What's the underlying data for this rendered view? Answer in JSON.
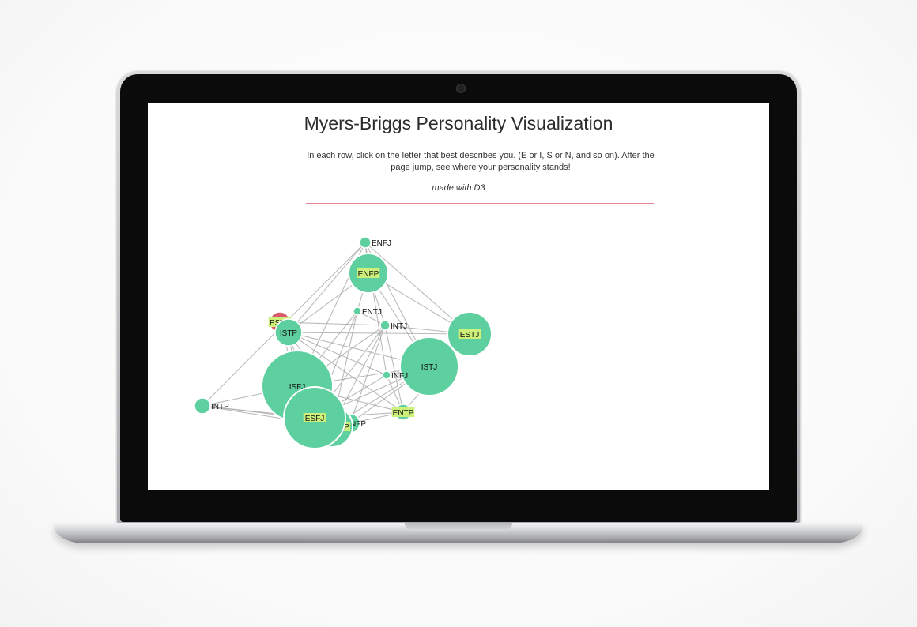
{
  "app": {
    "title": "Myers-Briggs Personality Visualization",
    "instructions": "In each row, click on the letter that best describes you. (E or I, S or N, and so on). After the page jump, see where your personality stands!",
    "credit": "made with D3"
  },
  "colors": {
    "node": "#5ecf9e",
    "node_highlight": "#d9596b",
    "label_highlight": "#ccf07a",
    "edge": "#a9a9a9",
    "divider": "#e28a98"
  },
  "graph": {
    "nodes": [
      {
        "id": "ENFJ",
        "size": "small",
        "highlight": false,
        "label_bg": false
      },
      {
        "id": "ENFP",
        "size": "medium",
        "highlight": false,
        "label_bg": true
      },
      {
        "id": "ENTJ",
        "size": "small",
        "highlight": false,
        "label_bg": false
      },
      {
        "id": "INTJ",
        "size": "small",
        "highlight": false,
        "label_bg": false
      },
      {
        "id": "ESTP",
        "size": "small",
        "highlight": true,
        "label_bg": true
      },
      {
        "id": "ISTP",
        "size": "small",
        "highlight": false,
        "label_bg": false
      },
      {
        "id": "ESTJ",
        "size": "medium",
        "highlight": false,
        "label_bg": true
      },
      {
        "id": "ISTJ",
        "size": "large",
        "highlight": false,
        "label_bg": false
      },
      {
        "id": "INFJ",
        "size": "small",
        "highlight": false,
        "label_bg": false
      },
      {
        "id": "ISFJ",
        "size": "large",
        "highlight": false,
        "label_bg": false
      },
      {
        "id": "INTP",
        "size": "small",
        "highlight": false,
        "label_bg": false
      },
      {
        "id": "ENTP",
        "size": "small",
        "highlight": false,
        "label_bg": true
      },
      {
        "id": "INFP",
        "size": "small",
        "highlight": false,
        "label_bg": false
      },
      {
        "id": "ISFP",
        "size": "medium",
        "highlight": false,
        "label_bg": true
      },
      {
        "id": "ESFJ",
        "size": "large",
        "highlight": false,
        "label_bg": true
      }
    ],
    "visible_labels": {
      "INFP": "NFP",
      "ISFP": "SFP"
    }
  }
}
